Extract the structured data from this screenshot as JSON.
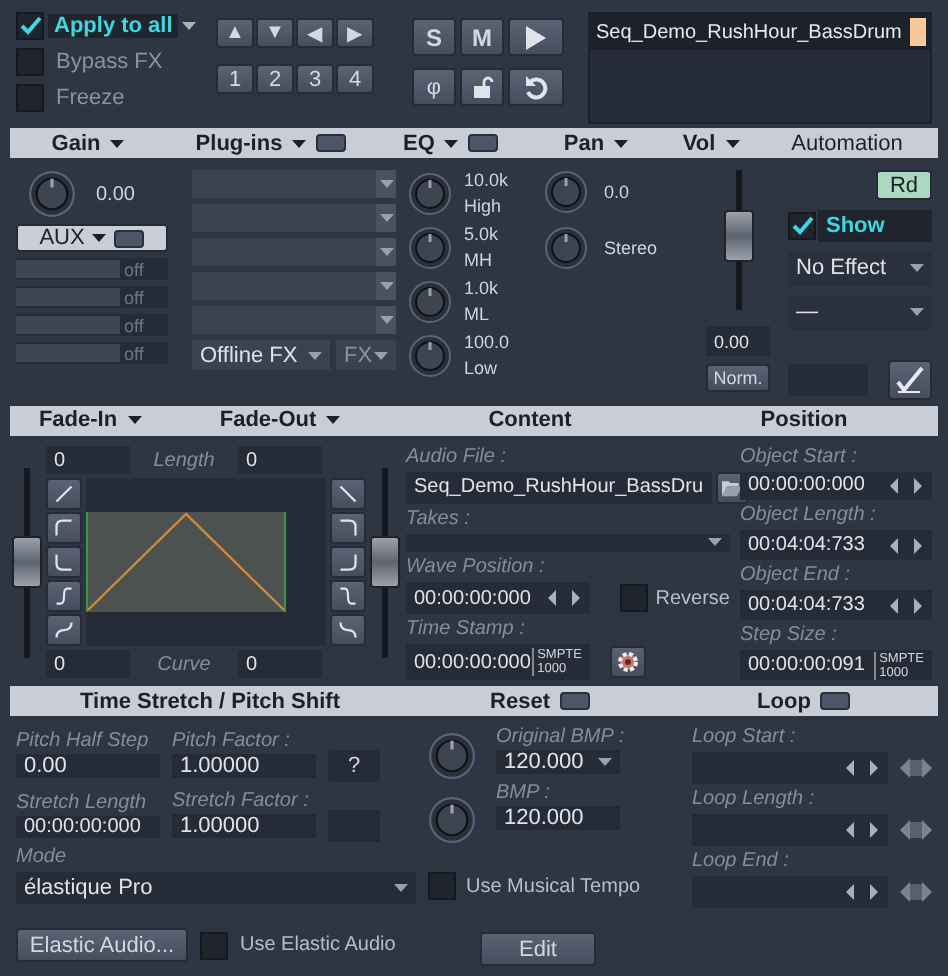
{
  "top": {
    "apply_all": {
      "label": "Apply to all",
      "checked": true
    },
    "options": [
      {
        "label": "Bypass FX",
        "checked": false
      },
      {
        "label": "Freeze",
        "checked": false
      }
    ],
    "arrow_buttons": [
      "▲",
      "▼",
      "◀",
      "▶"
    ],
    "number_buttons": [
      "1",
      "2",
      "3",
      "4"
    ],
    "solo": "S",
    "mute": "M",
    "phase": "φ",
    "object_name": "Seq_Demo_RushHour_BassDrum"
  },
  "mixer_header": [
    {
      "label": "Gain",
      "dropdown": true,
      "toggle": false
    },
    {
      "label": "Plug-ins",
      "dropdown": true,
      "toggle": true
    },
    {
      "label": "EQ",
      "dropdown": true,
      "toggle": true
    },
    {
      "label": "Pan",
      "dropdown": true,
      "toggle": false
    },
    {
      "label": "Vol",
      "dropdown": true,
      "toggle": false
    },
    {
      "label": "Automation",
      "dropdown": false,
      "toggle": false
    }
  ],
  "gain": {
    "value": "0.00",
    "aux": "AUX",
    "sends": [
      "off",
      "off",
      "off",
      "off"
    ]
  },
  "plugins": {
    "offline_fx": "Offline FX",
    "fx": "FX"
  },
  "eq": [
    {
      "value": "10.0k",
      "band": "High"
    },
    {
      "value": "5.0k",
      "band": "MH"
    },
    {
      "value": "1.0k",
      "band": "ML"
    },
    {
      "value": "100.0",
      "band": "Low"
    }
  ],
  "pan": {
    "value": "0.0",
    "mode": "Stereo"
  },
  "volume": {
    "level": 0.55,
    "value": "0.00",
    "normalize": "Norm."
  },
  "automation": {
    "read": "Rd",
    "show": {
      "label": "Show",
      "checked": true
    },
    "effect": "No Effect",
    "parameter": "—"
  },
  "fade_header": [
    {
      "label": "Fade-In",
      "dropdown": true
    },
    {
      "label": "Fade-Out",
      "dropdown": true
    },
    {
      "label": "Content",
      "dropdown": false
    },
    {
      "label": "Position",
      "dropdown": false
    }
  ],
  "fade": {
    "fade_in_length": "0",
    "length_label": "Length",
    "fade_out_length": "0",
    "fade_in_curve": "0",
    "curve_label": "Curve",
    "fade_out_curve": "0",
    "fade_in_fader": {
      "level": 0.5
    },
    "fade_out_fader": {
      "level": 0.5
    }
  },
  "content": {
    "audio_file_label": "Audio File :",
    "audio_file": "Seq_Demo_RushHour_BassDru",
    "takes_label": "Takes :",
    "wave_position_label": "Wave Position :",
    "wave_position": "00:00:00:000",
    "reverse": {
      "label": "Reverse",
      "checked": false
    },
    "time_stamp_label": "Time Stamp :",
    "time_stamp": "00:00:00:000",
    "time_stamp_unit": [
      "SMPTE",
      "1000"
    ]
  },
  "position": {
    "fields": [
      {
        "label": "Object Start :",
        "value": "00:00:00:000"
      },
      {
        "label": "Object Length :",
        "value": "00:04:04:733"
      },
      {
        "label": "Object End :",
        "value": "00:04:04:733"
      }
    ],
    "step_size_label": "Step Size :",
    "step_size": "00:00:00:091",
    "step_size_unit": [
      "SMPTE",
      "1000"
    ]
  },
  "stretch_header": [
    {
      "label": "Time Stretch / Pitch Shift",
      "toggle": false
    },
    {
      "label": "Reset",
      "toggle": true
    },
    {
      "label": "Loop",
      "toggle": true
    }
  ],
  "stretch": {
    "pitch_half_step_label": "Pitch Half Step",
    "pitch_half_step": "0.00",
    "pitch_factor_label": "Pitch Factor :",
    "pitch_factor": "1.00000",
    "help": "?",
    "stretch_length_label": "Stretch Length",
    "stretch_length": "00:00:00:000",
    "stretch_factor_label": "Stretch Factor :",
    "stretch_factor": "1.00000",
    "mode_label": "Mode",
    "mode": "élastique Pro",
    "original_bmp_label": "Original BMP :",
    "original_bmp": "120.000",
    "bmp_label": "BMP :",
    "bmp": "120.000",
    "musical_tempo": {
      "label": "Use Musical Tempo",
      "checked": false
    },
    "elastic_audio": "Elastic Audio...",
    "use_elastic": {
      "label": "Use Elastic Audio",
      "checked": false
    },
    "edit": "Edit"
  },
  "loop": [
    {
      "label": "Loop Start :"
    },
    {
      "label": "Loop Length :"
    },
    {
      "label": "Loop End :"
    }
  ]
}
